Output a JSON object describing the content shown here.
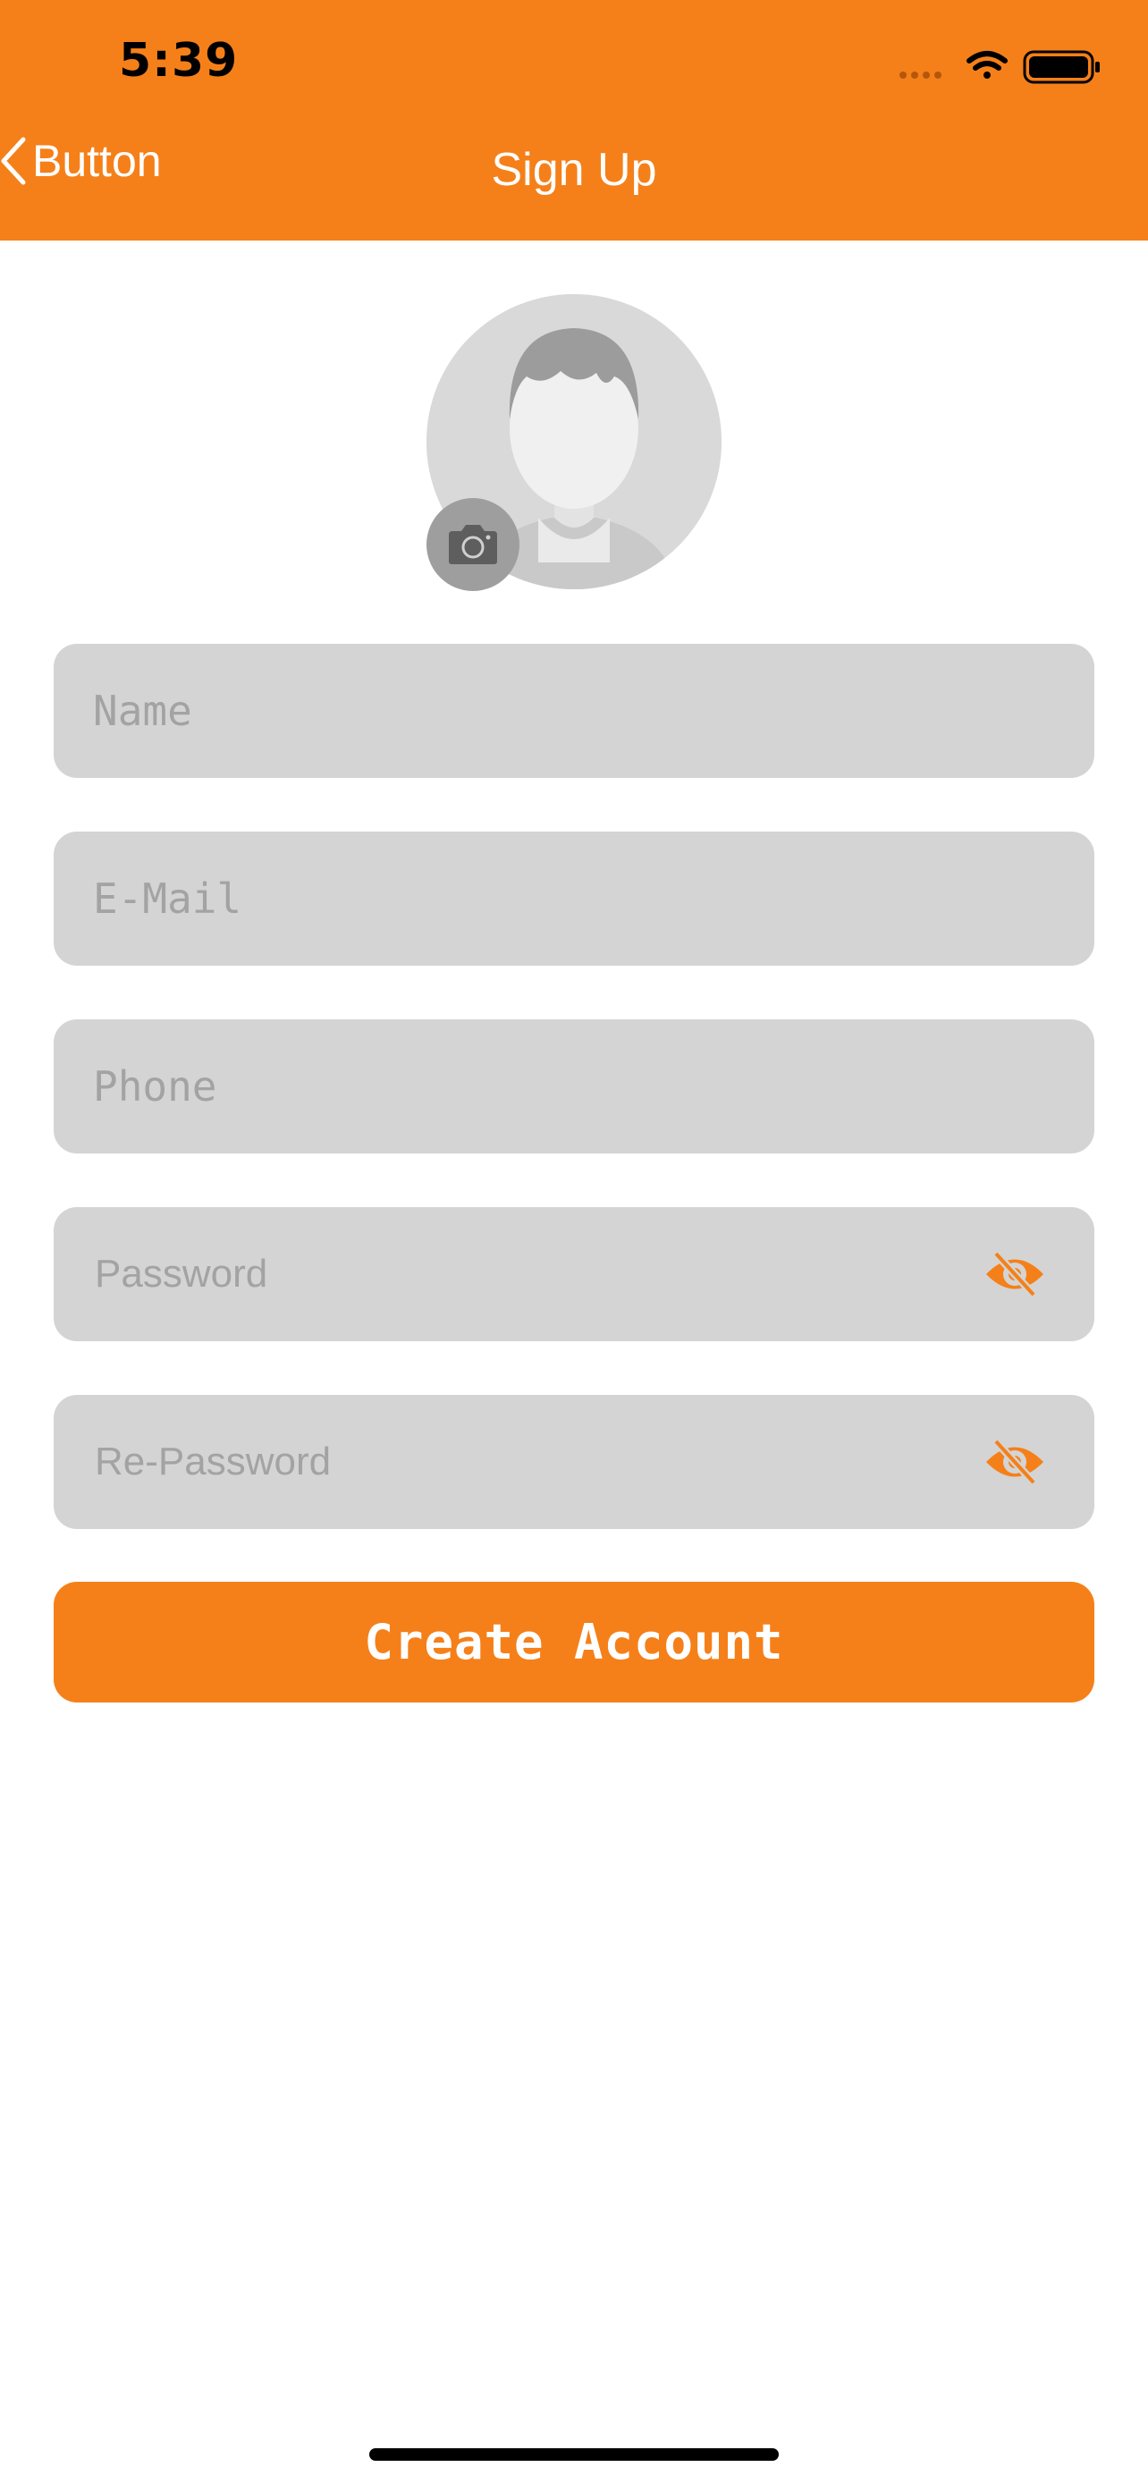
{
  "status_bar": {
    "time": "5:39"
  },
  "nav": {
    "back_label": "Button",
    "title": "Sign Up"
  },
  "form": {
    "name_placeholder": "Name",
    "email_placeholder": "E-Mail",
    "phone_placeholder": "Phone",
    "password_placeholder": "Password",
    "repassword_placeholder": "Re-Password"
  },
  "actions": {
    "create_label": "Create Account"
  },
  "icons": {
    "back": "chevron-left-icon",
    "camera": "camera-icon",
    "password_toggle": "eye-slash-icon",
    "avatar": "default-avatar-icon"
  },
  "colors": {
    "accent": "#F58019",
    "field_bg": "#D4D4D4",
    "placeholder": "#A3A3A3"
  }
}
